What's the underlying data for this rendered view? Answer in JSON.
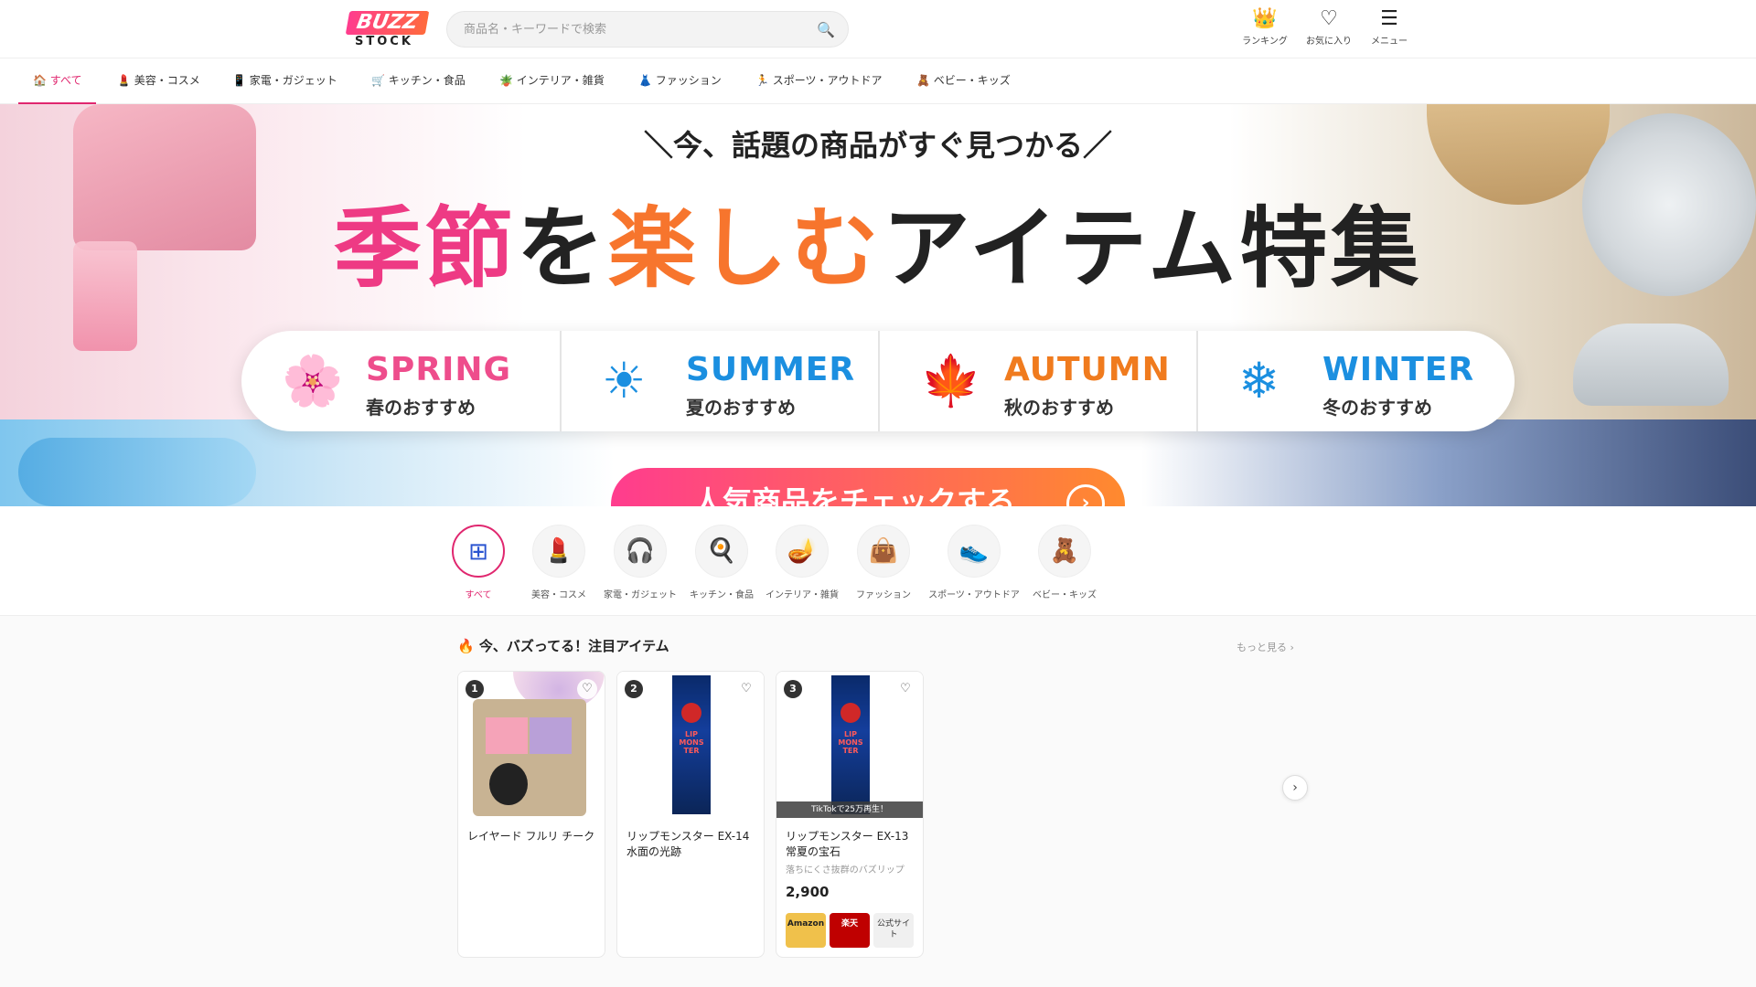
{
  "brand": {
    "logo_top": "BUZZ",
    "logo_bottom": "STOCK"
  },
  "search": {
    "placeholder": "商品名・キーワードで検索",
    "icon": "search-icon"
  },
  "header_nav": [
    {
      "label": "ランキング",
      "icon": "crown-icon",
      "glyph": "👑"
    },
    {
      "label": "お気に入り",
      "icon": "heart-icon",
      "glyph": "♡"
    },
    {
      "label": "メニュー",
      "icon": "menu-icon",
      "glyph": "☰"
    }
  ],
  "category_nav": [
    {
      "label": "すべて",
      "glyph": "🏠",
      "active": true
    },
    {
      "label": "美容・コスメ",
      "glyph": "💄"
    },
    {
      "label": "家電・ガジェット",
      "glyph": "📱"
    },
    {
      "label": "キッチン・食品",
      "glyph": "🛒"
    },
    {
      "label": "インテリア・雑貨",
      "glyph": "🪴"
    },
    {
      "label": "ファッション",
      "glyph": "👗"
    },
    {
      "label": "スポーツ・アウトドア",
      "glyph": "🏃"
    },
    {
      "label": "ベビー・キッズ",
      "glyph": "🧸"
    }
  ],
  "banner": {
    "tagline": "＼今、話題の商品がすぐ見つかる／",
    "title_part1": "季節",
    "title_part2": "を",
    "title_part3": "楽しむ",
    "title_part4": "アイテム特集",
    "seasons": [
      {
        "en": "SPRING",
        "jp": "春のおすすめ",
        "glyph": "🌸",
        "icon": "sakura-icon",
        "color": "#ee4d8c"
      },
      {
        "en": "SUMMER",
        "jp": "夏のおすすめ",
        "glyph": "☀",
        "icon": "sun-icon",
        "color": "#1b8fe0"
      },
      {
        "en": "AUTUMN",
        "jp": "秋のおすすめ",
        "glyph": "🍁",
        "icon": "maple-leaf-icon",
        "color": "#f07b1e"
      },
      {
        "en": "WINTER",
        "jp": "冬のおすすめ",
        "glyph": "❄",
        "icon": "snowflake-icon",
        "color": "#1b8fe0"
      }
    ],
    "cta": "人気商品をチェックする"
  },
  "category_circles": [
    {
      "label": "すべて",
      "glyph": "⊞",
      "active": true
    },
    {
      "label": "美容・コスメ",
      "glyph": "💄"
    },
    {
      "label": "家電・ガジェット",
      "glyph": "🎧"
    },
    {
      "label": "キッチン・食品",
      "glyph": "🍳"
    },
    {
      "label": "インテリア・雑貨",
      "glyph": "🪔"
    },
    {
      "label": "ファッション",
      "glyph": "👜"
    },
    {
      "label": "スポーツ・アウトドア",
      "glyph": "👟"
    },
    {
      "label": "ベビー・キッズ",
      "glyph": "🧸"
    }
  ],
  "section": {
    "title": "🔥 今、バズってる！注目アイテム",
    "more": "もっと見る ›"
  },
  "products": [
    {
      "rank": "1",
      "name": "レイヤード フルリ チーク",
      "image": "blush-palette"
    },
    {
      "rank": "2",
      "name": "リップモンスター EX-14 水面の光跡",
      "image": "lip-monster-tube"
    },
    {
      "rank": "3",
      "name": "リップモンスター EX-13 常夏の宝石",
      "image": "lip-monster-tube",
      "image_banner": "TikTokで25万再生！",
      "desc": "落ちにくさ抜群のバズリップ",
      "price": "2,900",
      "stores": [
        "Amazon",
        "楽天",
        "公式サイト"
      ]
    }
  ],
  "tube_text": "LIP MONS TER",
  "colors": {
    "accent": "#e0276f",
    "brand_orange": "#ff6a3d"
  }
}
